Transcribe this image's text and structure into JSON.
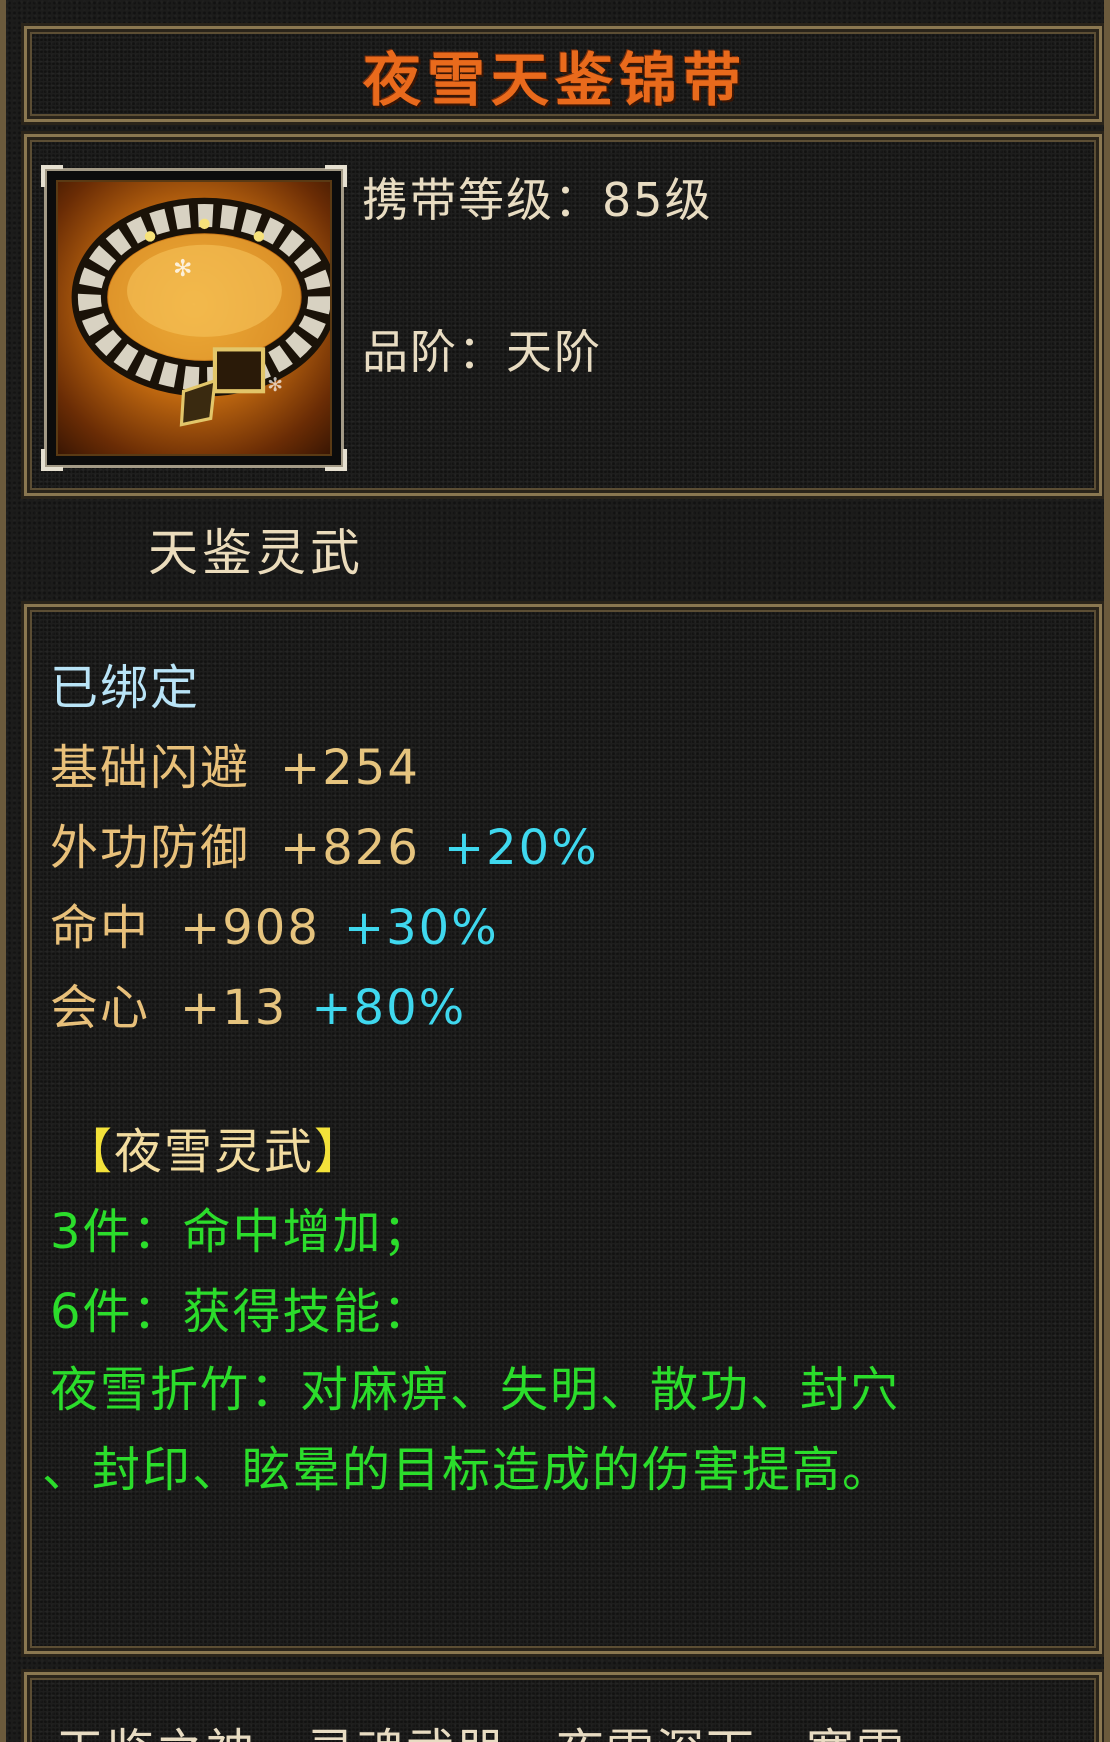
{
  "item": {
    "name": "夜雪天鉴锦带",
    "icon": "golden-belt-icon"
  },
  "header": {
    "level_label": "携带等级：",
    "level_value": "85级",
    "grade_label": "品阶：",
    "grade_value": "天阶"
  },
  "category": "天鉴灵武",
  "status": "已绑定",
  "stats": [
    {
      "name": "基础闪避",
      "value": "+254",
      "bonus": ""
    },
    {
      "name": "外功防御",
      "value": "+826",
      "bonus": "+20%"
    },
    {
      "name": "命中",
      "value": "+908",
      "bonus": "+30%"
    },
    {
      "name": "会心",
      "value": "+13",
      "bonus": "+80%"
    }
  ],
  "set": {
    "open_bracket": "【",
    "name": "夜雪灵武",
    "close_bracket": "】",
    "bonus_3": "3件：命中增加；",
    "bonus_6": "6件：获得技能：",
    "skill_line1": "夜雪折竹：对麻痹、失明、散功、封穴",
    "skill_line2": "、封印、眩晕的目标造成的伤害提高。"
  },
  "footer": {
    "text": "天鉴之神，灵魂武器，夜雪深下，寒雪"
  },
  "colors": {
    "title": "#e96a1c",
    "stat": "#e8c07a",
    "bonus": "#3fd8ee",
    "set_effect": "#2bdd2b",
    "bound": "#b9e4f7"
  }
}
